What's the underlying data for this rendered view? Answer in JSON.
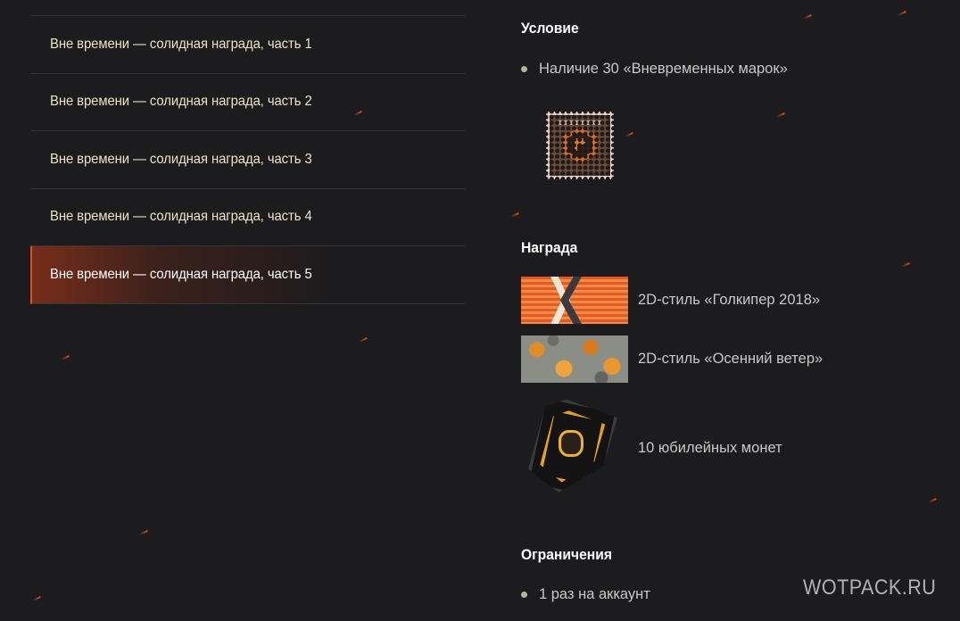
{
  "quests": [
    {
      "label": "Вне времени — солидная награда, часть 1",
      "active": false
    },
    {
      "label": "Вне времени — солидная награда, часть 2",
      "active": false
    },
    {
      "label": "Вне времени — солидная награда, часть 3",
      "active": false
    },
    {
      "label": "Вне времени — солидная награда, часть 4",
      "active": false
    },
    {
      "label": "Вне времени — солидная награда, часть 5",
      "active": true
    }
  ],
  "condition": {
    "title": "Условие",
    "items": [
      "Наличие 30 «Вневременных марок»"
    ],
    "icon": "timeless-stamp-icon"
  },
  "reward": {
    "title": "Награда",
    "items": [
      {
        "label": "2D-стиль «Голкипер 2018»",
        "icon": "goalkeeper-2018-style-icon"
      },
      {
        "label": "2D-стиль «Осенний ветер»",
        "icon": "autumn-wind-style-icon"
      },
      {
        "label": "10 юбилейных монет",
        "icon": "jubilee-coin-icon"
      }
    ]
  },
  "restrictions": {
    "title": "Ограничения",
    "items": [
      "1 раз на аккаунт"
    ]
  },
  "watermark": "WOTPACK.RU",
  "colors": {
    "background": "#1c1b1d",
    "active_accent": "#d2542a",
    "quest_text": "#efe4c4",
    "body_text": "#c8c8c8",
    "bullet": "#b8b497"
  }
}
